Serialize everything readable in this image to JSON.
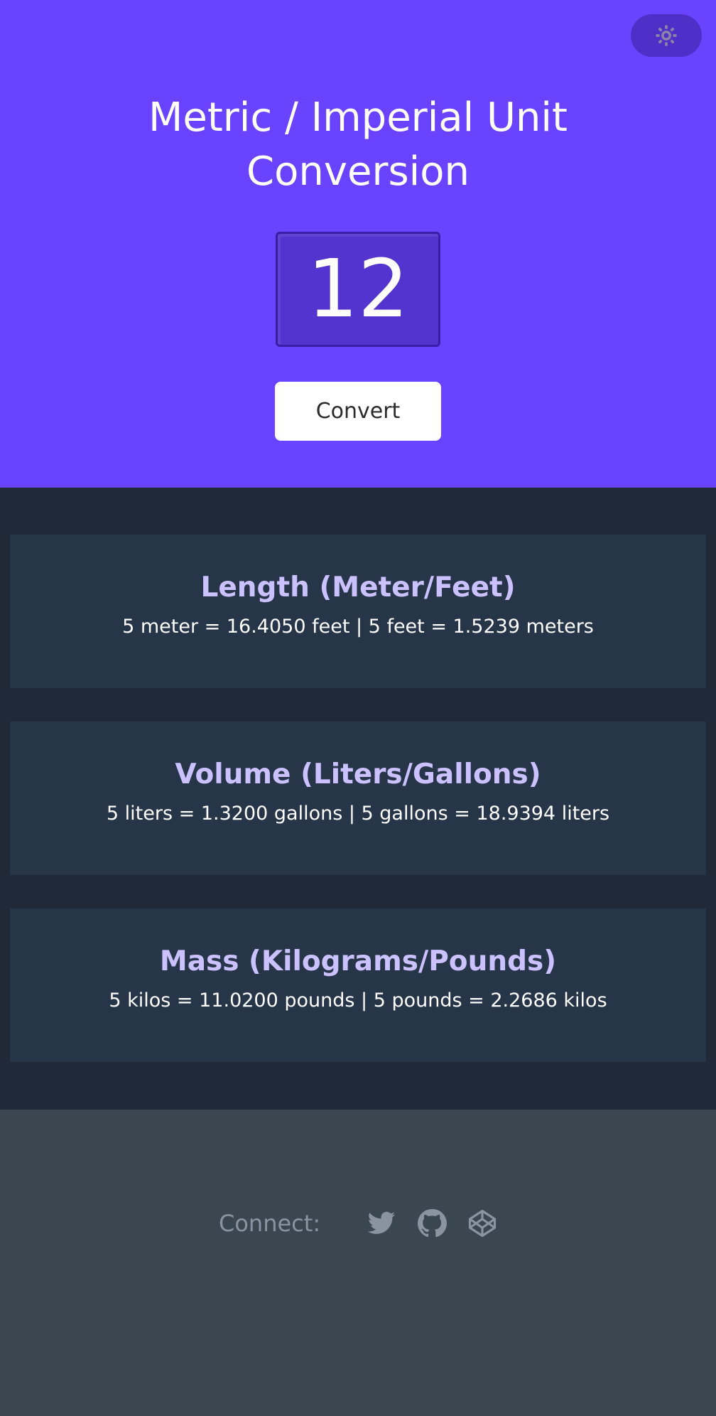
{
  "header": {
    "title": "Metric / Imperial Unit Conversion",
    "theme_icon": "sun-icon",
    "input_value": "12",
    "convert_label": "Convert"
  },
  "conversions": [
    {
      "title": "Length (Meter/Feet)",
      "result": "5 meter = 16.4050 feet | 5 feet = 1.5239 meters"
    },
    {
      "title": "Volume (Liters/Gallons)",
      "result": "5 liters = 1.3200 gallons | 5 gallons = 18.9394 liters"
    },
    {
      "title": "Mass (Kilograms/Pounds)",
      "result": "5 kilos = 11.0200 pounds | 5 pounds = 2.2686 kilos"
    }
  ],
  "footer": {
    "connect_label": "Connect:",
    "social_icons": [
      "twitter-icon",
      "github-icon",
      "codepen-icon"
    ]
  },
  "colors": {
    "accent": "#6943ff",
    "results_bg": "#1f2937",
    "card_bg": "#273549",
    "card_title": "#ccc1ff",
    "footer_bg": "#3a4751"
  }
}
